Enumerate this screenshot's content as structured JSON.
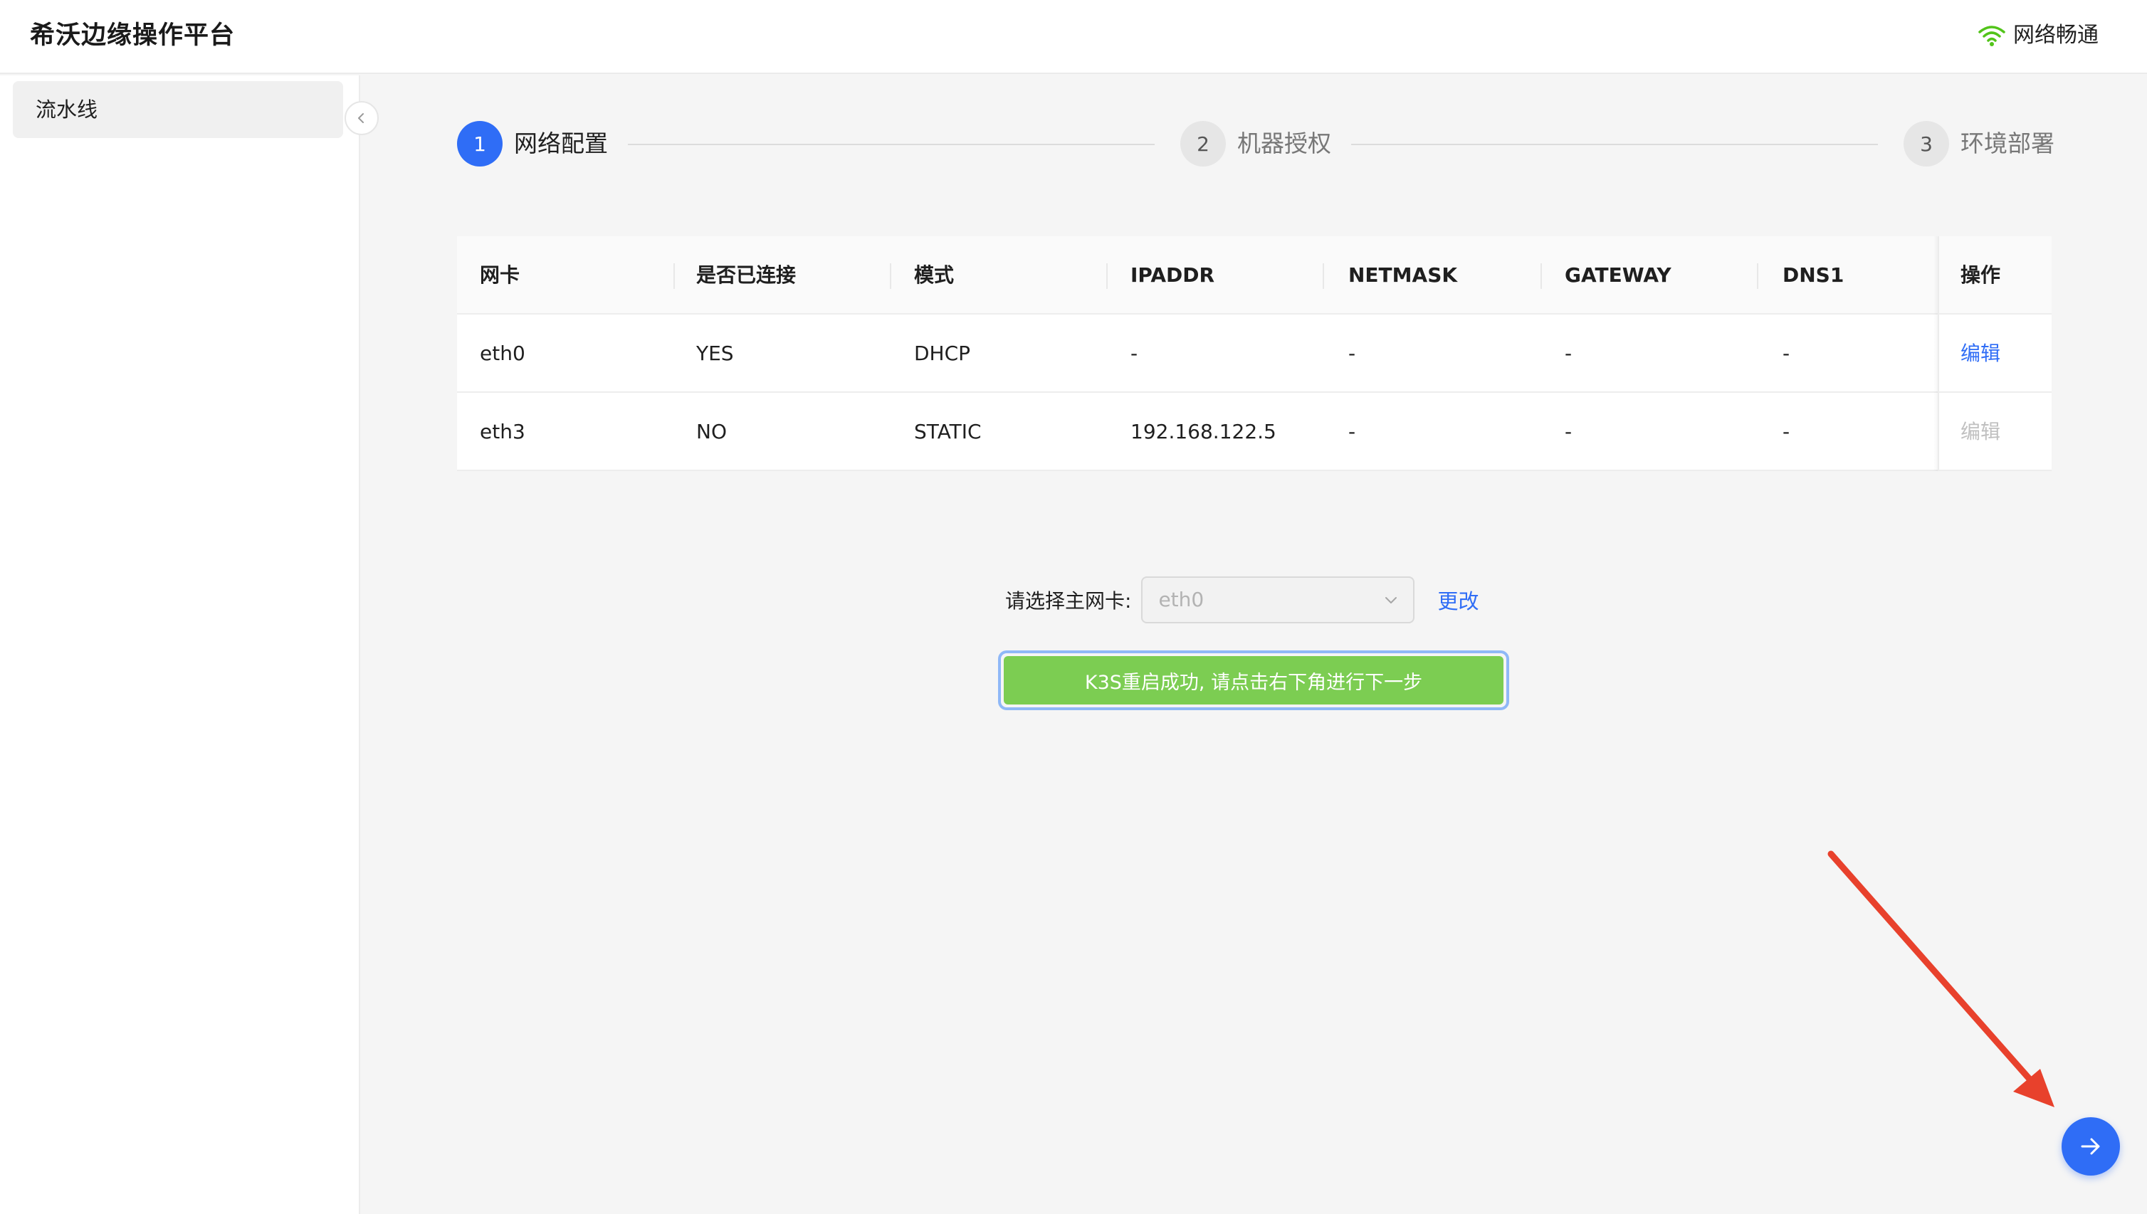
{
  "header": {
    "app_title": "希沃边缘操作平台",
    "network_status": "网络畅通",
    "network_icon": "wifi-icon",
    "network_color": "#52c41a"
  },
  "sidebar": {
    "items": [
      {
        "label": "流水线"
      }
    ]
  },
  "steps": [
    {
      "number": "1",
      "label": "网络配置",
      "state": "active"
    },
    {
      "number": "2",
      "label": "机器授权",
      "state": "inactive"
    },
    {
      "number": "3",
      "label": "环境部署",
      "state": "inactive"
    }
  ],
  "table": {
    "columns": [
      "网卡",
      "是否已连接",
      "模式",
      "IPADDR",
      "NETMASK",
      "GATEWAY",
      "DNS1",
      "操作"
    ],
    "rows": [
      {
        "nic": "eth0",
        "connected": "YES",
        "mode": "DHCP",
        "ipaddr": "-",
        "netmask": "-",
        "gateway": "-",
        "dns1": "-",
        "action": "编辑",
        "action_enabled": true
      },
      {
        "nic": "eth3",
        "connected": "NO",
        "mode": "STATIC",
        "ipaddr": "192.168.122.5",
        "netmask": "-",
        "gateway": "-",
        "dns1": "-",
        "action": "编辑",
        "action_enabled": false
      }
    ]
  },
  "primary_nic": {
    "label": "请选择主网卡:",
    "selected": "eth0",
    "change_label": "更改"
  },
  "status_message": "K3S重启成功, 请点击右下角进行下一步",
  "colors": {
    "accent": "#2f6df6",
    "success": "#7ccd52",
    "annotation_arrow": "#e8412c"
  }
}
